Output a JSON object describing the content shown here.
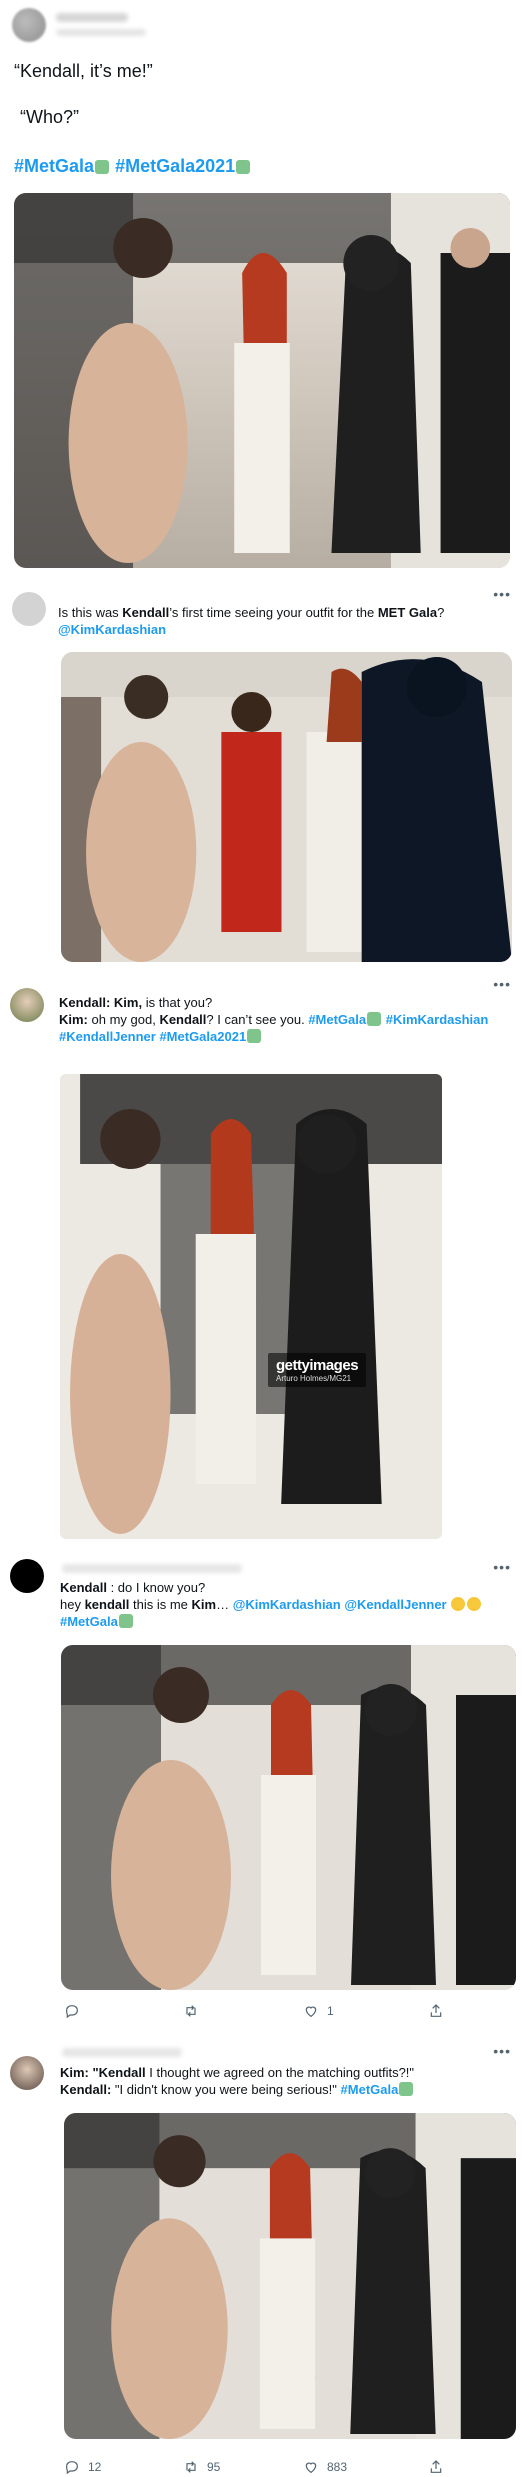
{
  "tweet1": {
    "line1": "“Kendall, it’s me!”",
    "line2": "“Who?”",
    "hashtag1": "#MetGala",
    "hashtag2": "#MetGala2021"
  },
  "tweet2": {
    "pre1": "Is this was ",
    "bold1": "Kendall",
    "pre2": "’s first time seeing your outfit for the ",
    "bold2": "MET Gala",
    "post": "?",
    "mention": "@KimKardashian"
  },
  "tweet3": {
    "l1_bold": "Kendall: Kim,",
    "l1_text": " is that you?",
    "l2_bold1": "Kim:",
    "l2_text1": " oh my god, ",
    "l2_bold2": "Kendall",
    "l2_text2": "? I can’t see you. ",
    "hashtag1": "#MetGala",
    "hashtag2": "#KimKardashian",
    "hashtag3": "#KendallJenner",
    "hashtag4": "#MetGala2021",
    "watermark_main": "gettyimages",
    "watermark_sub": "Arturo Holmes/MG21"
  },
  "tweet4": {
    "l1_bold": "Kendall",
    "l1_text": " : do I know you?",
    "l2_text1": "hey ",
    "l2_bold1": "kendall",
    "l2_text2": " this is me ",
    "l2_bold2": "Kim",
    "l2_text3": "… ",
    "mention1": "@KimKardashian",
    "mention2": "@KendallJenner",
    "hashtag": "#MetGala",
    "actions": {
      "reply": "",
      "retweet": "",
      "like": "1"
    }
  },
  "tweet5": {
    "l1_bold1": "Kim: \"Kendall",
    "l1_text": " I thought we agreed on the matching outfits?!\"",
    "l2_bold1": "Kendall:",
    "l2_text": " \"I didn't know you were being serious!\" ",
    "hashtag": "#MetGala",
    "actions": {
      "reply": "12",
      "retweet": "95",
      "like": "883"
    }
  },
  "icons": [
    "more-icon",
    "reply-icon",
    "retweet-icon",
    "like-icon",
    "share-icon"
  ],
  "colors": {
    "link": "#1d9bf0",
    "text": "#0f1419",
    "muted": "#536471"
  }
}
